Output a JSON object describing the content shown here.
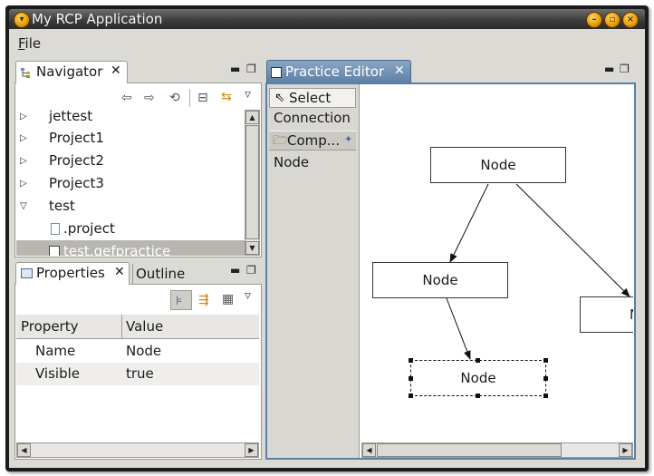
{
  "window": {
    "title": "My RCP Application"
  },
  "menu": {
    "file_mnemonic": "F",
    "file_rest": "ile"
  },
  "navigator": {
    "tab_label": "Navigator",
    "items": [
      {
        "label": "jettest",
        "expanded": false,
        "indent": 0
      },
      {
        "label": "Project1",
        "expanded": false,
        "indent": 0
      },
      {
        "label": "Project2",
        "expanded": false,
        "indent": 0
      },
      {
        "label": "Project3",
        "expanded": false,
        "indent": 0
      },
      {
        "label": "test",
        "expanded": true,
        "indent": 0
      },
      {
        "label": ".project",
        "indent": 1,
        "icon": "file-icon"
      },
      {
        "label": "test.gefpractice",
        "indent": 1,
        "icon": "gef-file-icon",
        "selected": true
      }
    ]
  },
  "properties": {
    "tab_label": "Properties",
    "outline_tab_label": "Outline",
    "columns": [
      "Property",
      "Value"
    ],
    "rows": [
      {
        "property": "Name",
        "value": "Node"
      },
      {
        "property": "Visible",
        "value": "true"
      }
    ]
  },
  "editor": {
    "tab_label": "Practice Editor",
    "palette": {
      "select_label": "Select",
      "connection_label": "Connection",
      "drawer_label": "Comp...",
      "node_tool_label": "Node"
    },
    "nodes": [
      {
        "label": "Node"
      },
      {
        "label": "Node"
      },
      {
        "label": "Node"
      },
      {
        "label": "N"
      }
    ]
  },
  "colors": {
    "editor_tab": "#5d7fa6",
    "frame": "#1b1b1b",
    "chrome": "#dcdad5",
    "selection": "#c5c3bd"
  }
}
